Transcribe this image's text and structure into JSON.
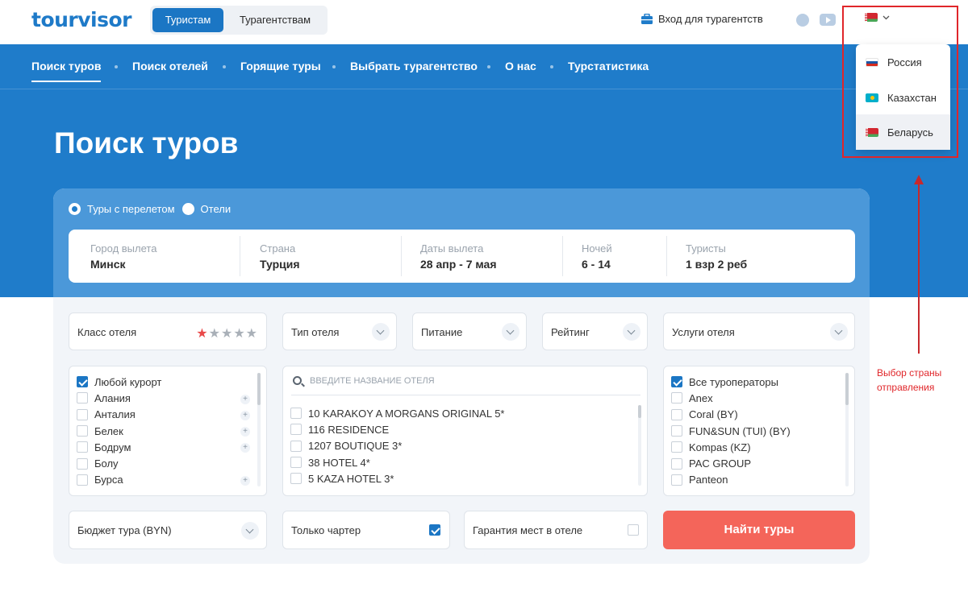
{
  "header": {
    "logo": "tourvisor",
    "segments": [
      "Туристам",
      "Турагентствам"
    ],
    "agent_login": "Вход для турагентств",
    "social_icons": [
      "plus-circle-icon",
      "youtube-icon"
    ],
    "current_country_flag": "flag-belarus"
  },
  "nav": {
    "items": [
      "Поиск туров",
      "Поиск отелей",
      "Горящие туры",
      "Выбрать турагентство",
      "О нас",
      "Турстатистика"
    ]
  },
  "page_title": "Поиск туров",
  "search": {
    "mode": {
      "options": [
        "Туры с перелетом",
        "Отели"
      ],
      "selected": "Туры с перелетом"
    },
    "fields": [
      {
        "label": "Город вылета",
        "value": "Минск"
      },
      {
        "label": "Страна",
        "value": "Турция"
      },
      {
        "label": "Даты вылета",
        "value": "28 апр - 7 мая"
      },
      {
        "label": "Ночей",
        "value": "6 - 14"
      },
      {
        "label": "Туристы",
        "value": "1 взр 2 реб"
      }
    ],
    "filters": {
      "hotel_class": {
        "label": "Класс отеля",
        "stars_total": 5,
        "stars_selected": 1
      },
      "hotel_type": "Тип отеля",
      "meal": "Питание",
      "rating": "Рейтинг",
      "services": "Услуги отеля"
    },
    "resorts": [
      {
        "name": "Любой курорт",
        "checked": true,
        "expandable": false
      },
      {
        "name": "Алания",
        "checked": false,
        "expandable": true
      },
      {
        "name": "Анталия",
        "checked": false,
        "expandable": true
      },
      {
        "name": "Белек",
        "checked": false,
        "expandable": true
      },
      {
        "name": "Бодрум",
        "checked": false,
        "expandable": true
      },
      {
        "name": "Болу",
        "checked": false,
        "expandable": false
      },
      {
        "name": "Бурса",
        "checked": false,
        "expandable": true
      }
    ],
    "hotel_search_placeholder": "ВВЕДИТЕ НАЗВАНИЕ ОТЕЛЯ",
    "hotels": [
      "10 KARAKOY A MORGANS ORIGINAL 5*",
      "116 RESIDENCE",
      "1207 BOUTIQUE 3*",
      "38 HOTEL 4*",
      "5 KAZA HOTEL 3*"
    ],
    "operators": [
      {
        "name": "Все туроператоры",
        "checked": true
      },
      {
        "name": "Anex",
        "checked": false
      },
      {
        "name": "Coral (BY)",
        "checked": false
      },
      {
        "name": "FUN&SUN (TUI) (BY)",
        "checked": false
      },
      {
        "name": "Kompas (KZ)",
        "checked": false
      },
      {
        "name": "PAC GROUP",
        "checked": false
      },
      {
        "name": "Panteon",
        "checked": false
      }
    ],
    "budget_label": "Бюджет тура (BYN)",
    "charter_only": {
      "label": "Только чартер",
      "checked": true
    },
    "guarantee": {
      "label": "Гарантия мест в отеле",
      "checked": false
    },
    "find_button": "Найти туры"
  },
  "country_dropdown": {
    "items": [
      {
        "name": "Россия",
        "flag": "flag-russia"
      },
      {
        "name": "Казахстан",
        "flag": "flag-kazakhstan"
      },
      {
        "name": "Беларусь",
        "flag": "flag-belarus",
        "selected": true
      }
    ]
  },
  "annotation": {
    "text": "Выбор страны отправления",
    "color": "#e0262a"
  },
  "colors": {
    "brand_blue": "#1f7cca",
    "button_red": "#f4655a",
    "star_active": "#e94a4a"
  }
}
